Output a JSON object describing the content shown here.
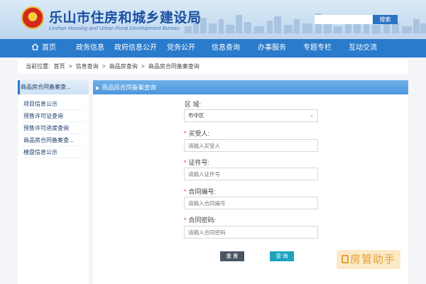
{
  "header": {
    "title": "乐山市住房和城乡建设局",
    "subtitle": "Leshan Housing and Urban Rural Development Bureau",
    "search_placeholder": "",
    "search_button": "搜索"
  },
  "nav": {
    "items": [
      "首页",
      "政务信息",
      "政府信息公开",
      "党务公开",
      "信息查询",
      "办事服务",
      "专题专栏",
      "互动交流"
    ]
  },
  "breadcrumb": {
    "prefix": "当前位置:",
    "items": [
      "首页",
      "信息查询",
      "商品房查询",
      "商品房合同备案查询"
    ],
    "separator": ">"
  },
  "sidebar": {
    "header": "商品房合同备案查...",
    "items": [
      "项目信息公示",
      "预售许可证查询",
      "预售许可进度查询",
      "商品房合同备案查...",
      "楼盘信息公示"
    ]
  },
  "main": {
    "title": "商品房合同备案查询",
    "fields": {
      "region": {
        "label": "区 域:",
        "value": "市中区"
      },
      "buyer": {
        "label": "买受人:",
        "placeholder": "请输入买受人"
      },
      "id_number": {
        "label": "证件号:",
        "placeholder": "请输入证件号"
      },
      "contract_no": {
        "label": "合同编号:",
        "placeholder": "请输入合同编号"
      },
      "contract_pwd": {
        "label": "合同密码:",
        "placeholder": "请输入合同密码"
      }
    },
    "reset_button": "重 置",
    "query_button": "查 询"
  },
  "watermark": {
    "text": "房管助手"
  },
  "colors": {
    "nav": "#2a7bcc",
    "title": "#1a4fa0",
    "query": "#1ea3bd",
    "reset": "#4a5563",
    "required": "#e23a3a"
  }
}
